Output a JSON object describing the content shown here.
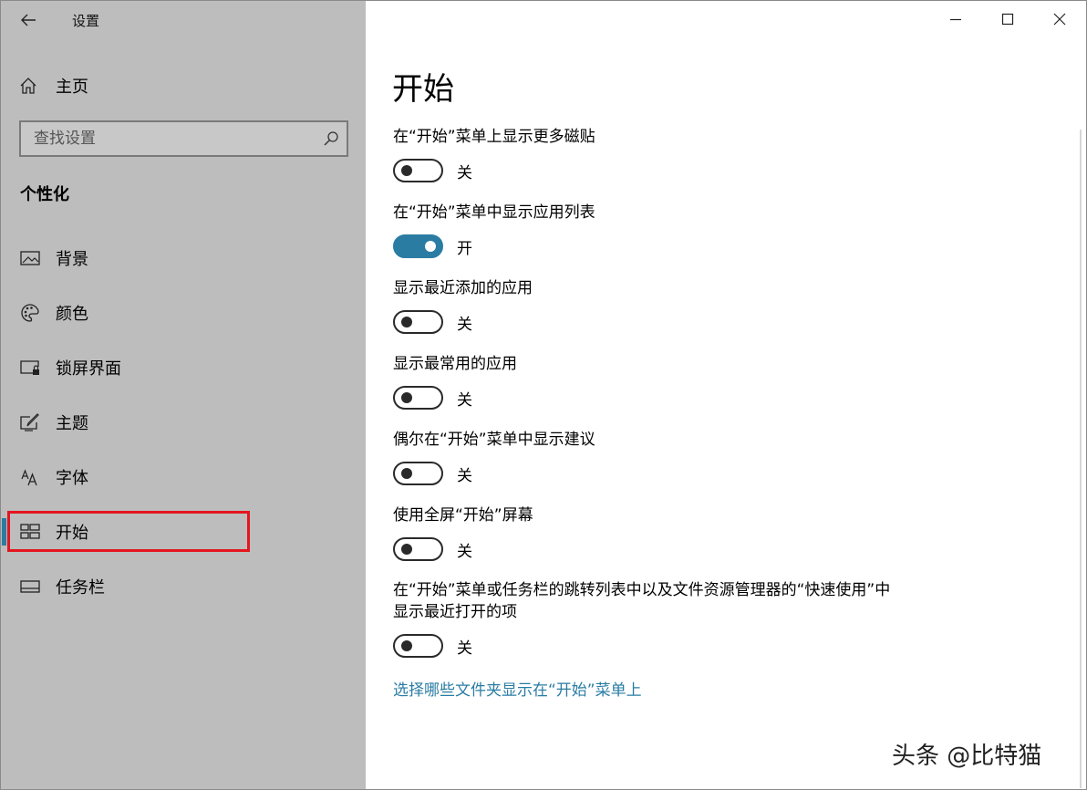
{
  "window": {
    "title": "设置",
    "controls": [
      "minimize",
      "maximize",
      "close"
    ]
  },
  "sidebar": {
    "home_label": "主页",
    "search_placeholder": "查找设置",
    "section_heading": "个性化",
    "items": [
      {
        "label": "背景",
        "icon": "image-icon"
      },
      {
        "label": "颜色",
        "icon": "palette-icon"
      },
      {
        "label": "锁屏界面",
        "icon": "lock-screen-icon"
      },
      {
        "label": "主题",
        "icon": "theme-icon"
      },
      {
        "label": "字体",
        "icon": "font-icon"
      },
      {
        "label": "开始",
        "icon": "start-icon",
        "selected": true
      },
      {
        "label": "任务栏",
        "icon": "taskbar-icon"
      }
    ]
  },
  "main": {
    "title": "开始",
    "settings": [
      {
        "label": "在“开始”菜单上显示更多磁贴",
        "state": "关",
        "on": false
      },
      {
        "label": "在“开始”菜单中显示应用列表",
        "state": "开",
        "on": true
      },
      {
        "label": "显示最近添加的应用",
        "state": "关",
        "on": false
      },
      {
        "label": "显示最常用的应用",
        "state": "关",
        "on": false
      },
      {
        "label": "偶尔在“开始”菜单中显示建议",
        "state": "关",
        "on": false
      },
      {
        "label": "使用全屏“开始”屏幕",
        "state": "关",
        "on": false
      },
      {
        "label_line1": "在“开始”菜单或任务栏的跳转列表中以及文件资源管理器的“快速使用”中",
        "label_line2": "显示最近打开的项",
        "state": "关",
        "on": false
      }
    ],
    "link": "选择哪些文件夹显示在“开始”菜单上"
  },
  "watermark": "头条 @比特猫",
  "colors": {
    "sidebar_bg": "#bdbdbd",
    "accent": "#2a7ca3",
    "highlight": "#e3151f"
  }
}
